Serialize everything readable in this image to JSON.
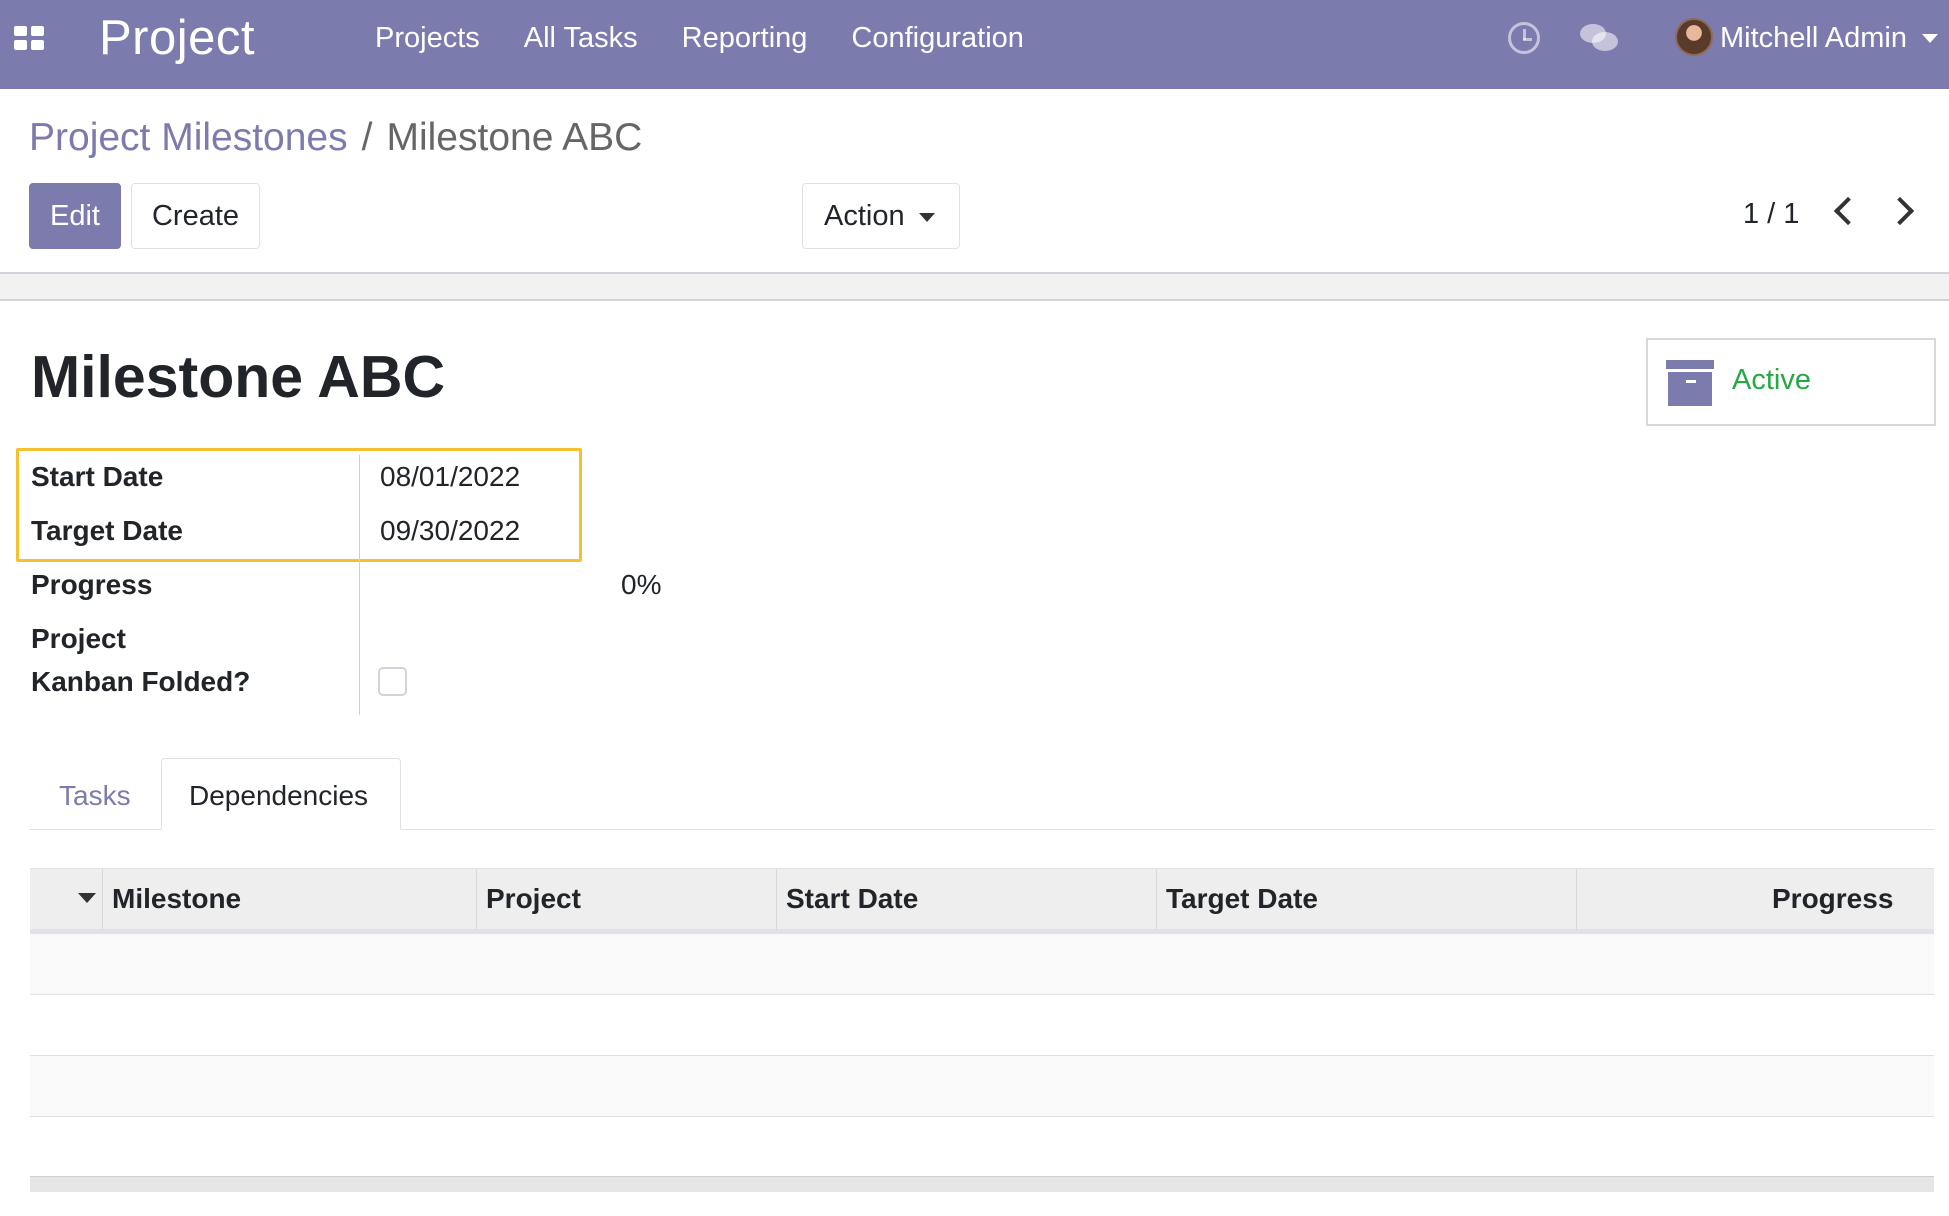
{
  "navbar": {
    "apps_icon": "apps-grid-icon",
    "brand": "Project",
    "menu": [
      "Projects",
      "All Tasks",
      "Reporting",
      "Configuration"
    ],
    "activity_icon": "clock-icon",
    "messages_icon": "chat-icon",
    "user": {
      "name": "Mitchell Admin",
      "avatar_icon": "avatar"
    },
    "color": "#7c7bad"
  },
  "breadcrumb": {
    "parent": "Project Milestones",
    "separator": "/",
    "current": "Milestone ABC"
  },
  "toolbar": {
    "edit_label": "Edit",
    "create_label": "Create",
    "action_label": "Action",
    "pager": "1 / 1"
  },
  "record": {
    "title": "Milestone ABC",
    "status_button": {
      "label": "Active",
      "icon": "archive-box-icon",
      "color": "#28a745"
    },
    "fields": {
      "start_date_label": "Start Date",
      "start_date": "08/01/2022",
      "target_date_label": "Target Date",
      "target_date": "09/30/2022",
      "progress_label": "Progress",
      "progress": "0%",
      "kanban_folded_label_1": "Project",
      "kanban_folded_label_2": "Kanban Folded?",
      "kanban_folded": false
    },
    "highlight_color": "#f7c033"
  },
  "tabs": [
    {
      "label": "Tasks",
      "active": false
    },
    {
      "label": "Dependencies",
      "active": true
    }
  ],
  "table": {
    "columns": [
      "Milestone",
      "Project",
      "Start Date",
      "Target Date",
      "Progress"
    ],
    "rows": []
  }
}
